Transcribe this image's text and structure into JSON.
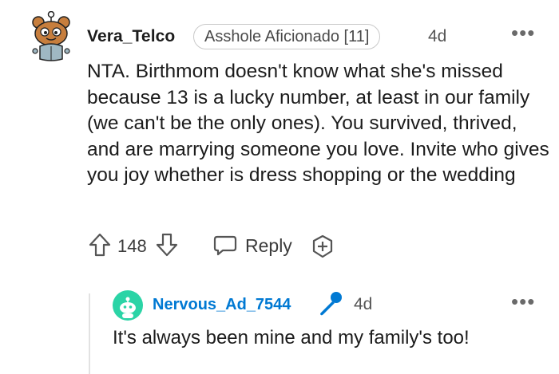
{
  "top_comment": {
    "username": "Vera_Telco",
    "flair": "Asshole Aficionado [11]",
    "age": "4d",
    "more_label": "•••",
    "body": "NTA. Birthmom doesn't know what she's missed because 13 is a lucky number, at least in our family (we can't be the only ones). You survived, thrived, and are marrying someone you love. Invite who gives you joy whether is dress shopping or the wedding",
    "score": "148",
    "reply_label": "Reply",
    "avatar_icon": "snoo-bear-avatar",
    "upvote_icon": "upvote-arrow",
    "downvote_icon": "downvote-arrow",
    "reply_icon": "speech-bubble",
    "award_icon": "plus-award"
  },
  "reply_comment": {
    "username": "Nervous_Ad_7544",
    "age": "4d",
    "more_label": "•••",
    "body": "It's always been mine and my family's too!",
    "avatar_icon": "snoo-avatar",
    "badge_icon": "microphone",
    "accent_color": "#0079d3",
    "avatar_color": "#2bd4a6"
  }
}
